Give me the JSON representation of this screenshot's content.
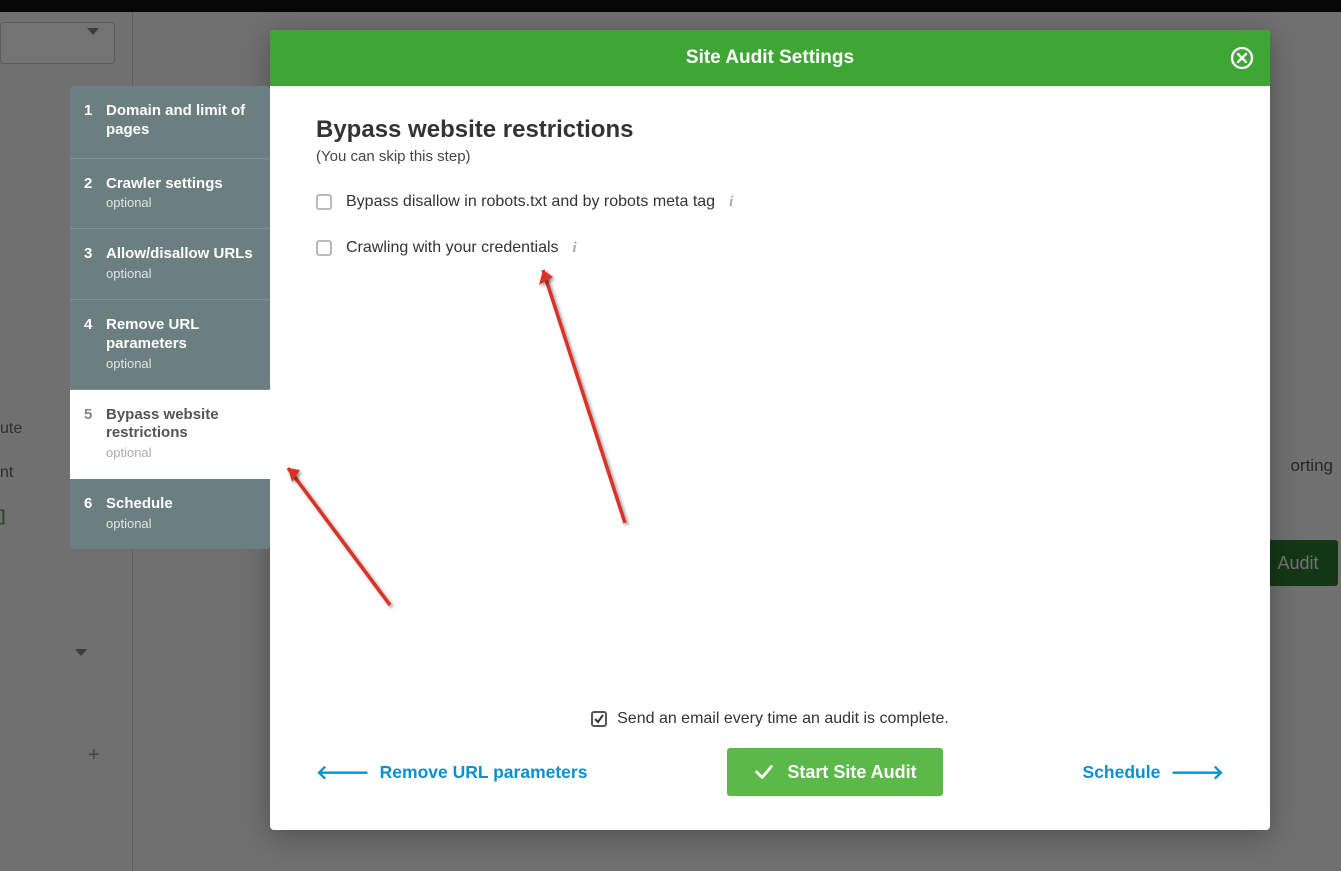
{
  "modal": {
    "header_title": "Site Audit Settings",
    "body_title": "Bypass website restrictions",
    "body_subtitle": "(You can skip this step)",
    "options": {
      "bypass_robots": "Bypass disallow in robots.txt and by robots meta tag",
      "crawl_credentials": "Crawling with your credentials"
    },
    "email_notice": "Send an email every time an audit is complete.",
    "back_label": "Remove URL parameters",
    "start_label": "Start Site Audit",
    "next_label": "Schedule"
  },
  "wizard": {
    "steps": [
      {
        "num": "1",
        "title": "Domain and limit of pages",
        "optional": ""
      },
      {
        "num": "2",
        "title": "Crawler settings",
        "optional": "optional"
      },
      {
        "num": "3",
        "title": "Allow/disallow URLs",
        "optional": "optional"
      },
      {
        "num": "4",
        "title": "Remove URL parameters",
        "optional": "optional"
      },
      {
        "num": "5",
        "title": "Bypass website restrictions",
        "optional": "optional"
      },
      {
        "num": "6",
        "title": "Schedule",
        "optional": "optional"
      }
    ]
  },
  "background": {
    "partial_word_1": "ute",
    "partial_word_2": "nt",
    "partial_word_3": "orting",
    "audit_btn": "Audit",
    "plus": "+"
  }
}
